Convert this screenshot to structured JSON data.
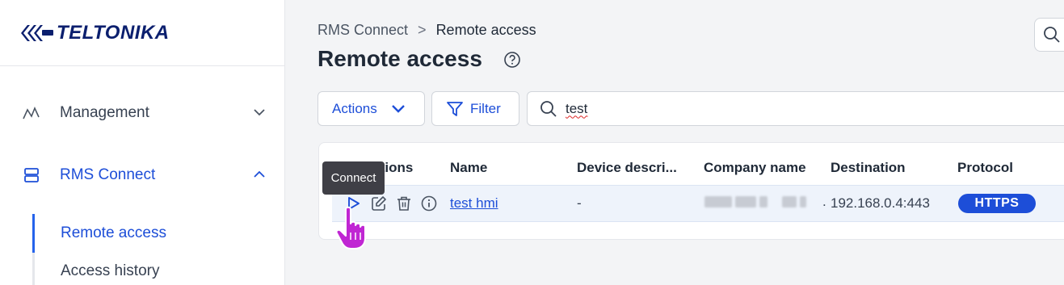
{
  "sidebar": {
    "logo_text": "TELTONIKA",
    "items": [
      {
        "label": "Management",
        "icon": "activity-icon",
        "expanded": false
      },
      {
        "label": "RMS Connect",
        "icon": "server-icon",
        "expanded": true
      }
    ],
    "sub_items": [
      {
        "label": "Remote access",
        "active": true
      },
      {
        "label": "Access history",
        "active": false
      }
    ]
  },
  "breadcrumb": {
    "parent": "RMS Connect",
    "separator": ">",
    "current": "Remote access"
  },
  "page": {
    "title": "Remote access"
  },
  "toolbar": {
    "actions_label": "Actions",
    "filter_label": "Filter",
    "search_value": "test"
  },
  "table": {
    "columns": [
      "Actions",
      "Name",
      "Device descri...",
      "Company name",
      "Destination",
      "Protocol"
    ],
    "rows": [
      {
        "name": "test hmi",
        "device_description": "-",
        "company_name_suffix": ".",
        "destination": "192.168.0.4:443",
        "protocol": "HTTPS"
      }
    ],
    "row_action_icons": [
      "play-icon",
      "edit-icon",
      "trash-icon",
      "info-icon"
    ]
  },
  "tooltip": {
    "text": "Connect"
  },
  "colors": {
    "accent": "#1d4ed8",
    "row_highlight": "#eef3fb",
    "tooltip_bg": "#3f3f46",
    "cursor": "#c026d3"
  }
}
